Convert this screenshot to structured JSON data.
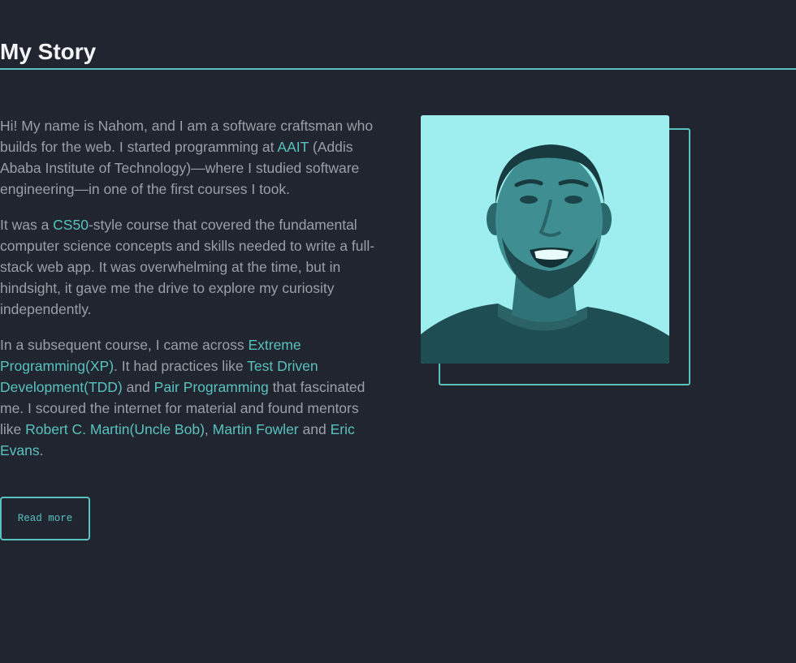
{
  "section": {
    "title": "My Story"
  },
  "paragraphs": {
    "p1": {
      "t1": "Hi! My name is Nahom, and I am a software craftsman who builds for the web. I started programming at ",
      "link_aait": "AAIT",
      "t2": " (Addis Ababa Institute of Technology)—where I studied software engineering—in one of the first courses I took."
    },
    "p2": {
      "t1": "It was a ",
      "link_cs50": "CS50",
      "t2": "-style course that covered the fundamental computer science concepts and skills needed to write a full-stack web app. It was overwhelming at the time, but in hindsight, it gave me the drive to explore my curiosity independently."
    },
    "p3": {
      "t1": "In a subsequent course, I came across ",
      "link_xp": "Extreme Programming(XP)",
      "t2": ". It had practices like ",
      "link_tdd": "Test Driven Development(TDD)",
      "t3": " and ",
      "link_pair": "Pair Programming",
      "t4": " that fascinated me. I scoured the internet for material and found mentors like ",
      "link_bob": "Robert C. Martin(Uncle Bob)",
      "t5": ", ",
      "link_fowler": "Martin Fowler",
      "t6": " and ",
      "link_evans": "Eric Evans",
      "t7": "."
    }
  },
  "read_more_label": "Read more",
  "photo": {
    "icon": "portrait-photo",
    "tint_color": "#9eeeef"
  },
  "colors": {
    "background": "#21252f",
    "accent": "#58c2bf",
    "heading": "#f3f4f6",
    "body_text": "#9a9fa8"
  }
}
